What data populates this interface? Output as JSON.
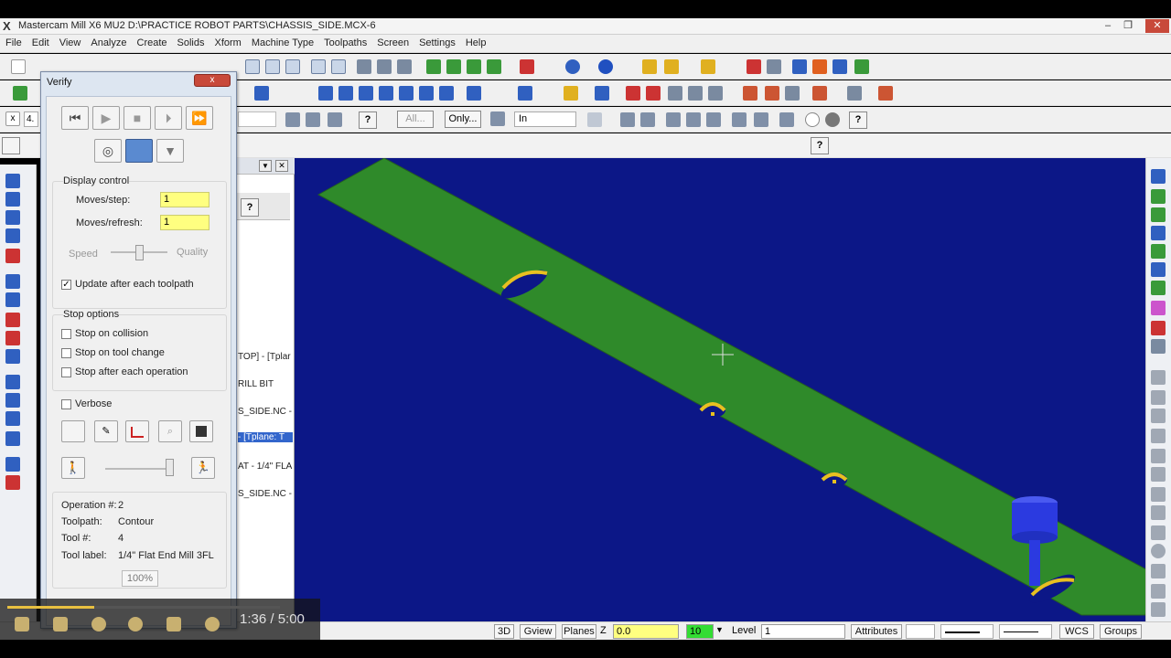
{
  "window": {
    "logo": "X",
    "title": "Mastercam Mill X6 MU2  D:\\PRACTICE ROBOT PARTS\\CHASSIS_SIDE.MCX-6",
    "controls": [
      "‒",
      "❐",
      "✕"
    ]
  },
  "menu": [
    "File",
    "Edit",
    "View",
    "Analyze",
    "Create",
    "Solids",
    "Xform",
    "Machine Type",
    "Toolpaths",
    "Screen",
    "Settings",
    "Help"
  ],
  "toolbar3": {
    "coord_value": "4.",
    "all_button": "All...",
    "only_button": "Only...",
    "units_select": "In",
    "help_glyph": "?"
  },
  "operations_manager": {
    "help_glyph": "?",
    "lines": [
      "TOP] - [Tplar",
      "RILL BIT",
      "S_SIDE.NC -",
      "- [Tplane: T",
      "AT - 1/4\" FLA",
      "S_SIDE.NC -"
    ]
  },
  "verify": {
    "title": "Verify",
    "close_glyph": "x",
    "display_control_label": "Display control",
    "moves_step_label": "Moves/step:",
    "moves_step_value": "1",
    "moves_refresh_label": "Moves/refresh:",
    "moves_refresh_value": "1",
    "speed_label": "Speed",
    "quality_label": "Quality",
    "speed_quality_position": 0.5,
    "update_label": "Update after each toolpath",
    "update_checked": "✓",
    "stop_options_label": "Stop options",
    "stop_collision_label": "Stop on collision",
    "stop_tool_change_label": "Stop on tool change",
    "stop_each_op_label": "Stop after each operation",
    "verbose_label": "Verbose",
    "playback_position": 0.95,
    "operation_label": "Operation #:",
    "operation_value": "2",
    "toolpath_label": "Toolpath:",
    "toolpath_value": "Contour",
    "tool_num_label": "Tool #:",
    "tool_num_value": "4",
    "tool_label_label": "Tool label:",
    "tool_label_value": "1/4\" Flat End Mill 3FL",
    "progress": "100%"
  },
  "status_bar": {
    "btn_3d": "3D",
    "btn_gview": "Gview",
    "btn_planes": "Planes",
    "z_label": "Z",
    "z_value": "0.0",
    "level_value": "10",
    "level_label": "Level",
    "level_select": "1",
    "attributes": "Attributes",
    "wcs": "WCS",
    "groups": "Groups"
  },
  "video_player": {
    "time": "1:36 / 5:00",
    "progress": 0.32
  },
  "colors": {
    "viewport_bg": "#0c1787",
    "part_green": "#2f8a2a",
    "slot_yellow": "#e8c020",
    "tool_blue": "#2b3ae0"
  }
}
